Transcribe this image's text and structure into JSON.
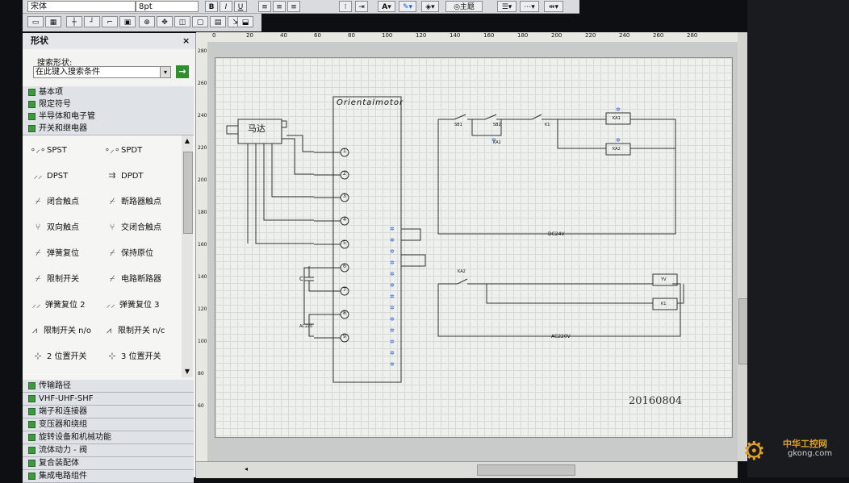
{
  "toolbar": {
    "font_name": "宋体",
    "font_size": "8pt",
    "bold": "B",
    "italic": "I",
    "underline": "U",
    "theme_label": "主题"
  },
  "shapes_panel": {
    "title": "形状",
    "search_label": "搜索形状:",
    "search_placeholder": "在此键入搜索条件",
    "top_categories": [
      "基本项",
      "限定符号",
      "半导体和电子管",
      "开关和继电器"
    ],
    "shapes": [
      {
        "left": "SPST",
        "right": "SPDT"
      },
      {
        "left": "DPST",
        "right": "DPDT"
      },
      {
        "left": "闭合触点",
        "right": "断路器触点"
      },
      {
        "left": "双向触点",
        "right": "交闭合触点"
      },
      {
        "left": "弹簧复位",
        "right": "保持原位"
      },
      {
        "left": "限制开关",
        "right": "电路断路器"
      },
      {
        "left": "弹簧复位 2",
        "right": "弹簧复位 3"
      },
      {
        "left": "限制开关 n/o",
        "right": "限制开关 n/c"
      },
      {
        "left": "2 位置开关",
        "right": "3 位置开关"
      }
    ],
    "bottom_categories": [
      "传输路径",
      "VHF-UHF-SHF",
      "端子和连接器",
      "变压器和绕组",
      "旋转设备和机械功能",
      "流体动力 - 阀",
      "复合装配体",
      "集成电路组件"
    ]
  },
  "ruler": {
    "top_ticks": [
      "0",
      "20",
      "40",
      "60",
      "80",
      "100",
      "120",
      "140",
      "160",
      "180",
      "200",
      "220",
      "240",
      "260",
      "280"
    ],
    "left_ticks": [
      "280",
      "260",
      "240",
      "220",
      "200",
      "180",
      "160",
      "140",
      "120",
      "100",
      "80",
      "60"
    ]
  },
  "drawing": {
    "motor_label": "马达",
    "box_title": "Orientalmotor",
    "terminals": [
      "1",
      "2",
      "3",
      "4",
      "5",
      "6",
      "7",
      "8",
      "9"
    ],
    "capacitor_label": "C",
    "ac_small": "AC220",
    "sb1": "SB1",
    "sb2": "SB2",
    "ka_contact": "KA1",
    "k1": "K1",
    "ka1": "KA1",
    "ka2": "KA2",
    "dc_label": "DC24V",
    "ac_label": "AC220V",
    "ka2_contact": "KA2",
    "relay_1": "YV",
    "relay_2": "K1",
    "date": "20160804"
  },
  "watermark": {
    "site": "中华工控网",
    "domain": "gkong.com"
  },
  "colors": {
    "category_icon": "#3c9a3c",
    "search_go": "#2f8f2f",
    "screen_dark": "#1a1b1e"
  }
}
